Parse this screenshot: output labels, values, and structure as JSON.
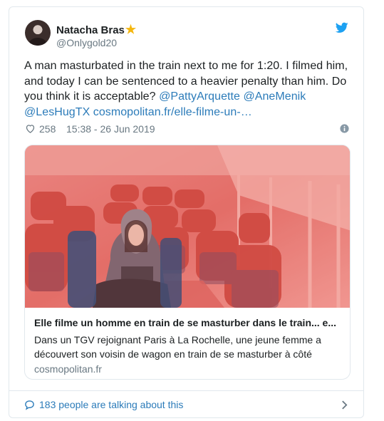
{
  "user": {
    "display_name": "Natacha Bras",
    "handle": "@Onlygold20"
  },
  "icons": {
    "star": "★",
    "bird": "twitter-bird-icon",
    "heart": "heart-icon",
    "info": "info-icon",
    "bubble": "speech-bubble-icon",
    "chevron": "chevron-right-icon"
  },
  "colors": {
    "link": "#2b7bb9",
    "secondary_text": "#697882",
    "primary_text": "#1c2022",
    "twitter_blue": "#1da1f2",
    "star": "#f5b70f"
  },
  "tweet": {
    "text": "A man masturbated in the train next to me for 1:20. I filmed him, and today I can be sentenced to a heavier penalty than him. Do you think it is acceptable?",
    "mentions": [
      "@PattyArquette",
      "@AneMenik",
      "@LesHugTX"
    ],
    "link": "cosmopolitan.fr/elle-filme-un-…",
    "likes": "258",
    "timestamp": "15:38 - 26 Jun 2019"
  },
  "card": {
    "title": "Elle filme un homme en train de se masturber dans le train... e...",
    "description": "Dans un TGV rejoignant Paris à La Rochelle, une jeune femme a découvert son voisin de wagon en train de se masturber à côté",
    "domain": "cosmopolitan.fr"
  },
  "footer": {
    "talking": "183 people are talking about this"
  }
}
